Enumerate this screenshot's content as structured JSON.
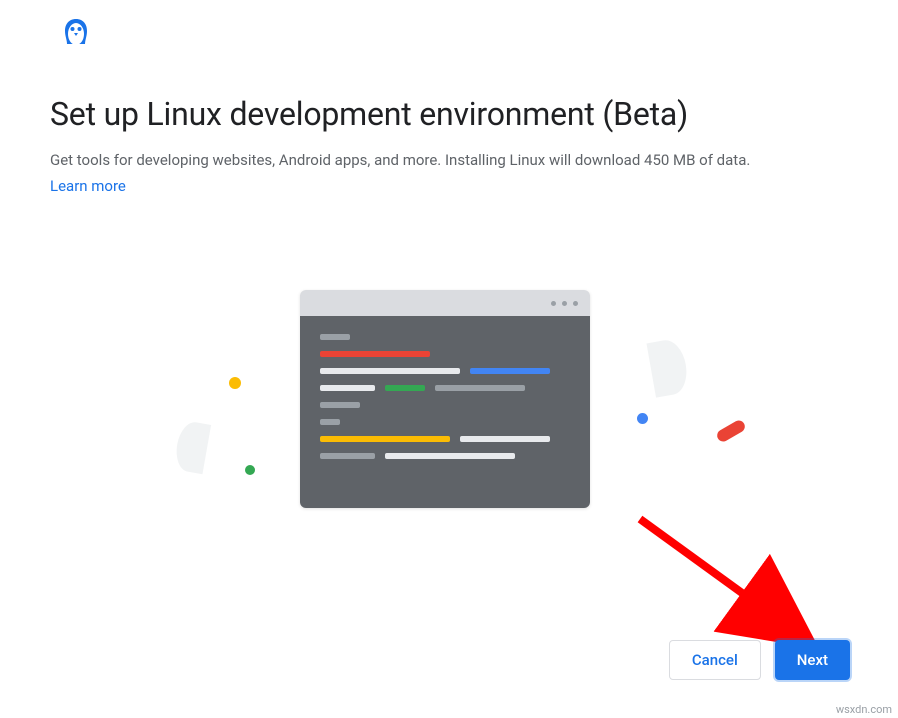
{
  "header": {
    "icon": "penguin-icon"
  },
  "title": "Set up Linux development environment (Beta)",
  "description": "Get tools for developing websites, Android apps, and more. Installing Linux will download 450 MB of data.",
  "learnMore": "Learn more",
  "buttons": {
    "cancel": "Cancel",
    "next": "Next"
  },
  "watermark": "wsxdn.com",
  "colors": {
    "primary": "#1a73e8",
    "red": "#ea4335",
    "yellow": "#fbbc04",
    "green": "#34a853",
    "blue": "#4285f4",
    "gray": "#5f6368"
  }
}
